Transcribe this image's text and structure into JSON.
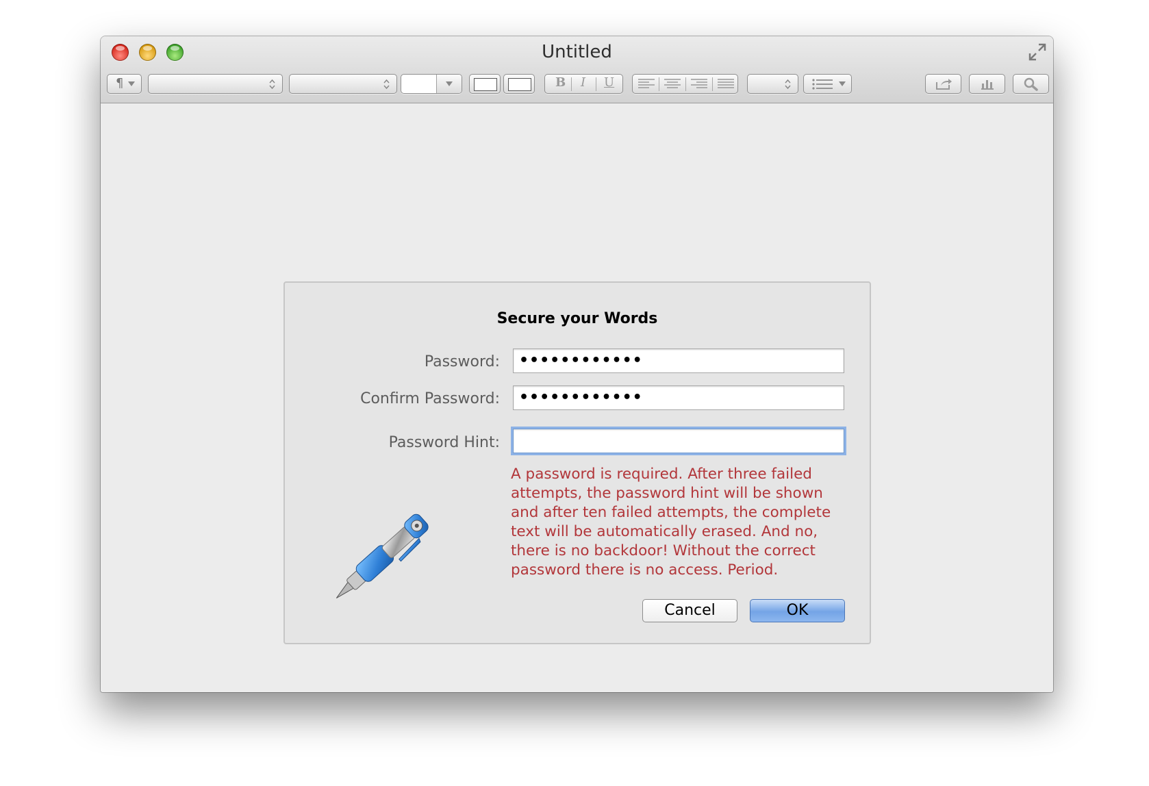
{
  "window": {
    "title": "Untitled"
  },
  "toolbar": {
    "paragraph_symbol": "¶",
    "bold": "B",
    "italic": "I",
    "underline": "U"
  },
  "dialog": {
    "title": "Secure your Words",
    "password_label": "Password:",
    "password_value": "••••••••••••",
    "confirm_label": "Confirm Password:",
    "confirm_value": "••••••••••••",
    "hint_label": "Password Hint:",
    "hint_value": "",
    "warning_text": "A password is required. After three failed attempts, the password hint will be shown and after ten failed attempts, the complete text will be automatically erased. And no, there is no backdoor! Without the correct password there is no access. Period.",
    "cancel_label": "Cancel",
    "ok_label": "OK"
  },
  "colors": {
    "warning": "#b2363a",
    "default_button": "#74a4e6",
    "focus_ring": "#8db2e6"
  },
  "icons": [
    "close-icon",
    "minimize-icon",
    "zoom-icon",
    "fullscreen-icon",
    "paragraph-icon",
    "align-left-icon",
    "align-center-icon",
    "align-right-icon",
    "justify-icon",
    "list-icon",
    "share-icon",
    "chart-icon",
    "search-icon",
    "pen-icon"
  ]
}
